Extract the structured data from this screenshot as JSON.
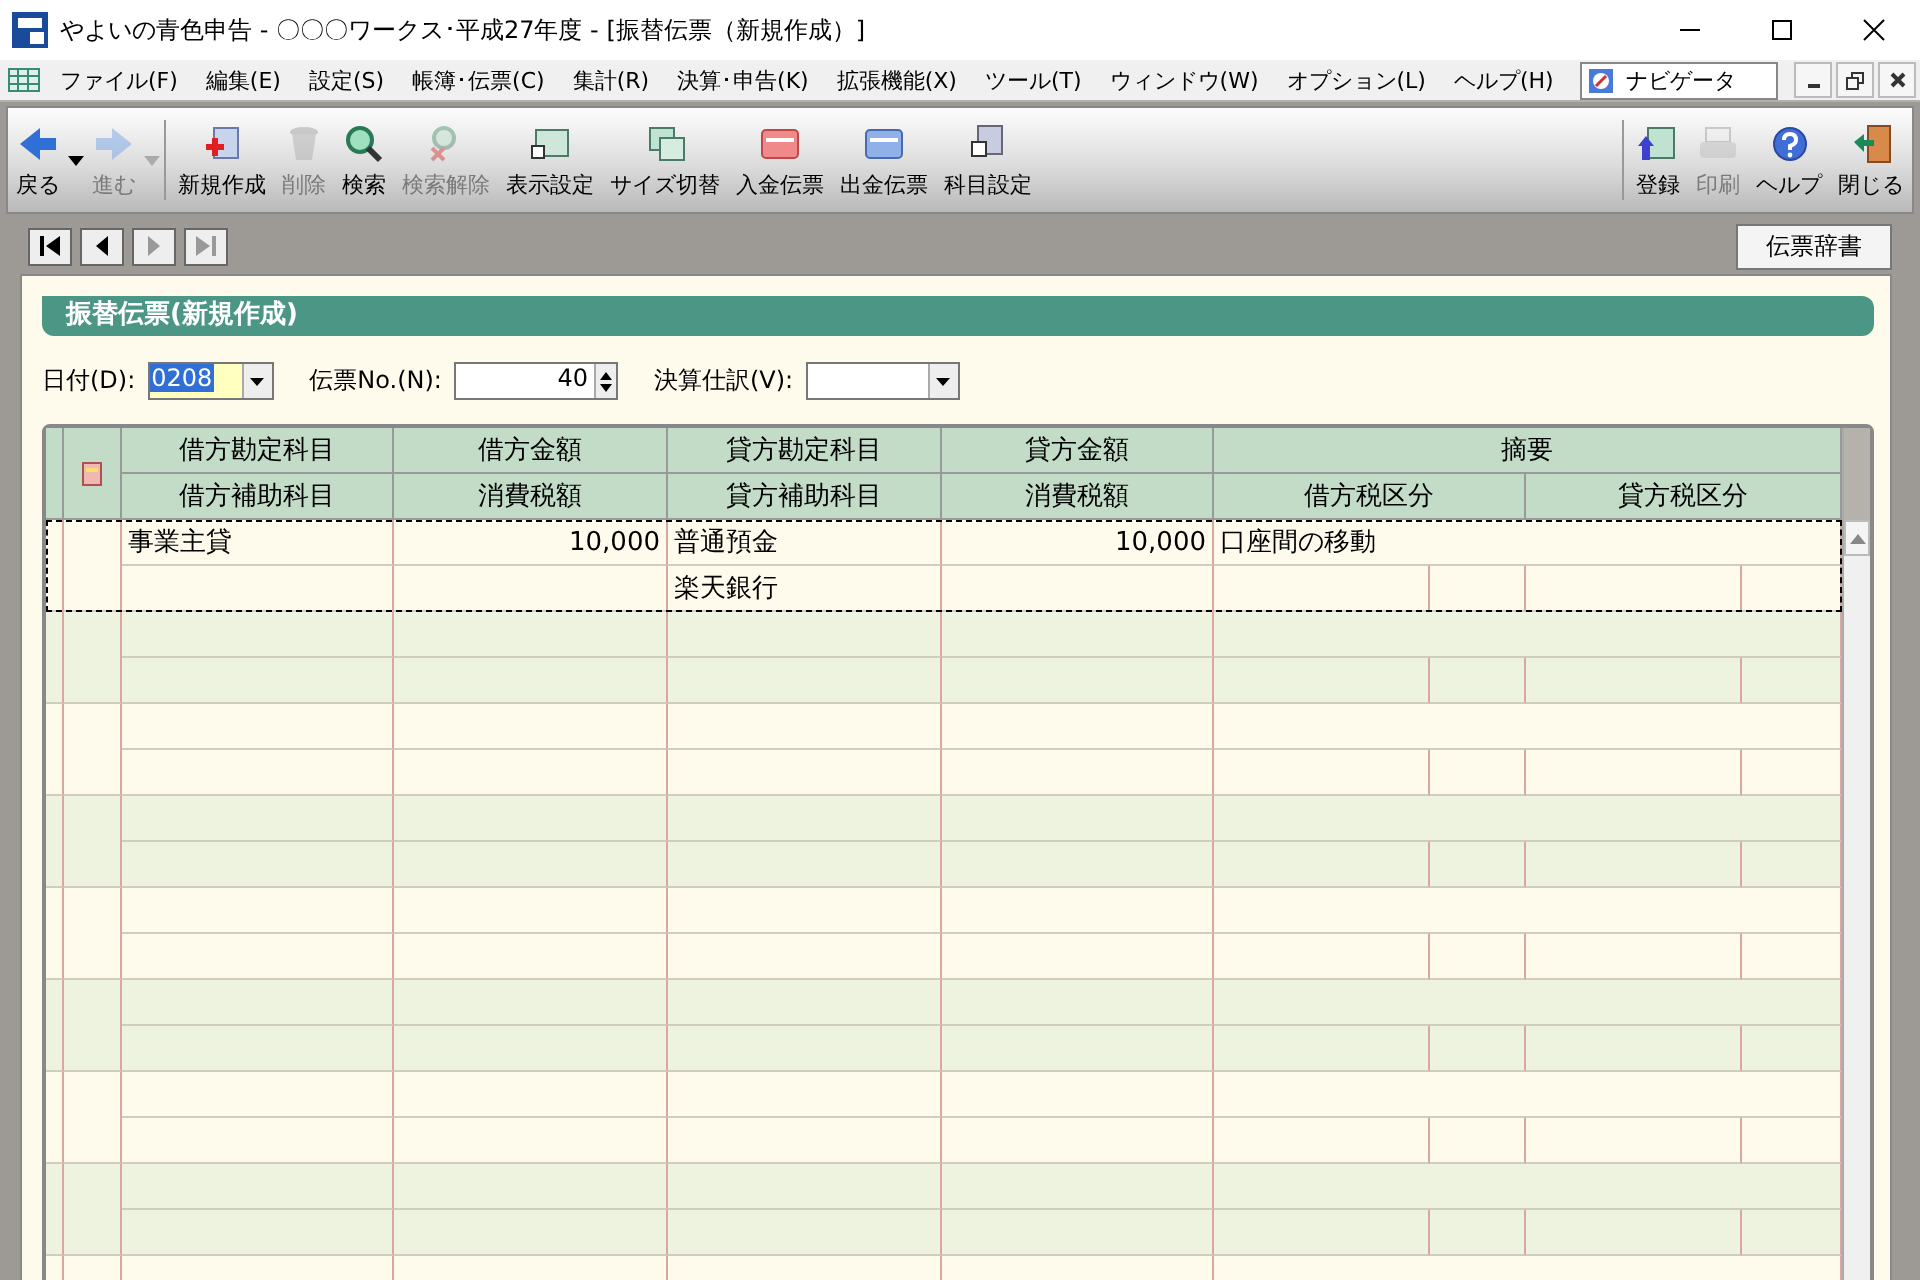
{
  "window": {
    "title": "やよいの青色申告 - 〇〇〇ワークス･平成27年度 - [振替伝票（新規作成）]"
  },
  "menu": {
    "items": [
      "ファイル(F)",
      "編集(E)",
      "設定(S)",
      "帳簿･伝票(C)",
      "集計(R)",
      "決算･申告(K)",
      "拡張機能(X)",
      "ツール(T)",
      "ウィンドウ(W)",
      "オプション(L)",
      "ヘルプ(H)"
    ],
    "navigator": "ナビゲータ"
  },
  "toolbar": {
    "items": [
      {
        "label": "戻る",
        "disabled": false,
        "dropdown": true
      },
      {
        "label": "進む",
        "disabled": true,
        "dropdown": true
      },
      {
        "label": "新規作成",
        "disabled": false,
        "dropdown": false
      },
      {
        "label": "削除",
        "disabled": true,
        "dropdown": false
      },
      {
        "label": "検索",
        "disabled": false,
        "dropdown": false
      },
      {
        "label": "検索解除",
        "disabled": true,
        "dropdown": false
      },
      {
        "label": "表示設定",
        "disabled": false,
        "dropdown": false
      },
      {
        "label": "サイズ切替",
        "disabled": false,
        "dropdown": false
      },
      {
        "label": "入金伝票",
        "disabled": false,
        "dropdown": false
      },
      {
        "label": "出金伝票",
        "disabled": false,
        "dropdown": false
      },
      {
        "label": "科目設定",
        "disabled": false,
        "dropdown": false
      }
    ],
    "right_items": [
      {
        "label": "登録",
        "disabled": false
      },
      {
        "label": "印刷",
        "disabled": true
      },
      {
        "label": "ヘルプ",
        "disabled": false
      },
      {
        "label": "閉じる",
        "disabled": false
      }
    ]
  },
  "dictionary_button": "伝票辞書",
  "form": {
    "title": "振替伝票(新規作成)",
    "date": {
      "label": "日付(D):",
      "value": "0208"
    },
    "slip_no": {
      "label": "伝票No.(N):",
      "value": "40"
    },
    "closing_entry": {
      "label": "決算仕訳(V):"
    }
  },
  "grid": {
    "header_top": [
      "借方勘定科目",
      "借方金額",
      "貸方勘定科目",
      "貸方金額",
      "摘要"
    ],
    "header_bottom": [
      "借方補助科目",
      "消費税額",
      "貸方補助科目",
      "消費税額",
      "借方税区分",
      "貸方税区分"
    ],
    "entries": [
      {
        "selected": true,
        "debit_account": "事業主貸",
        "debit_amount": "10,000",
        "credit_account": "普通預金",
        "credit_amount": "10,000",
        "description": "口座間の移動",
        "credit_sub": "楽天銀行"
      }
    ]
  }
}
